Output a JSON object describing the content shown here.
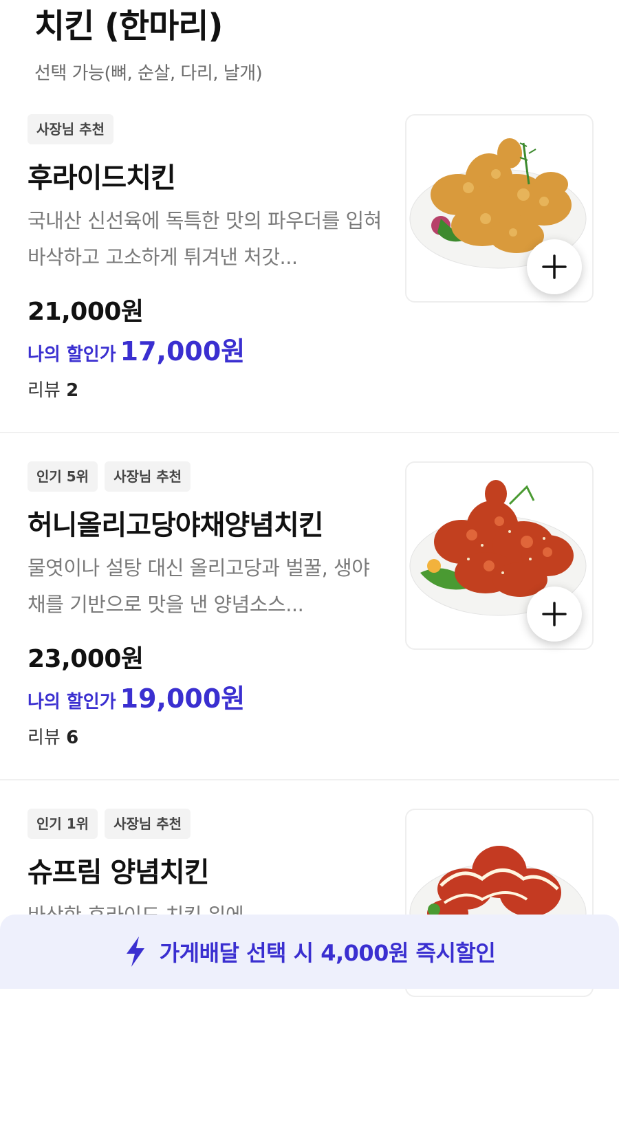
{
  "category": {
    "title": "치킨 (한마리)",
    "subtitle": "선택 가능(뼈, 순살, 다리, 날개)"
  },
  "colors": {
    "accent": "#3a2fd0",
    "promo_bg": "#eef0fc",
    "badge_bg": "#f3f3f3"
  },
  "items": [
    {
      "badges": [
        "사장님 추천"
      ],
      "name": "후라이드치킨",
      "description": "국내산 신선육에 독특한 맛의 파우더를 입혀 바삭하고 고소하게 튀겨낸 처갓...",
      "price": "21,000원",
      "discount_label": "나의 할인가",
      "discount_price": "17,000원",
      "review_label": "리뷰",
      "review_count": "2",
      "image_icon": "fried-chicken-photo"
    },
    {
      "badges": [
        "인기 5위",
        "사장님 추천"
      ],
      "name": "허니올리고당야채양념치킨",
      "description": "물엿이나 설탕 대신 올리고당과 벌꿀, 생야채를 기반으로 맛을 낸 양념소스...",
      "price": "23,000원",
      "discount_label": "나의 할인가",
      "discount_price": "19,000원",
      "review_label": "리뷰",
      "review_count": "6",
      "image_icon": "seasoned-chicken-photo"
    },
    {
      "badges": [
        "인기 1위",
        "사장님 추천"
      ],
      "name": "슈프림 양념치킨",
      "description": "바삭한 후라이드 치킨 위에",
      "image_icon": "supreme-chicken-photo"
    }
  ],
  "promo": {
    "text": "가게배달 선택 시 4,000원 즉시할인",
    "icon": "lightning-icon"
  }
}
